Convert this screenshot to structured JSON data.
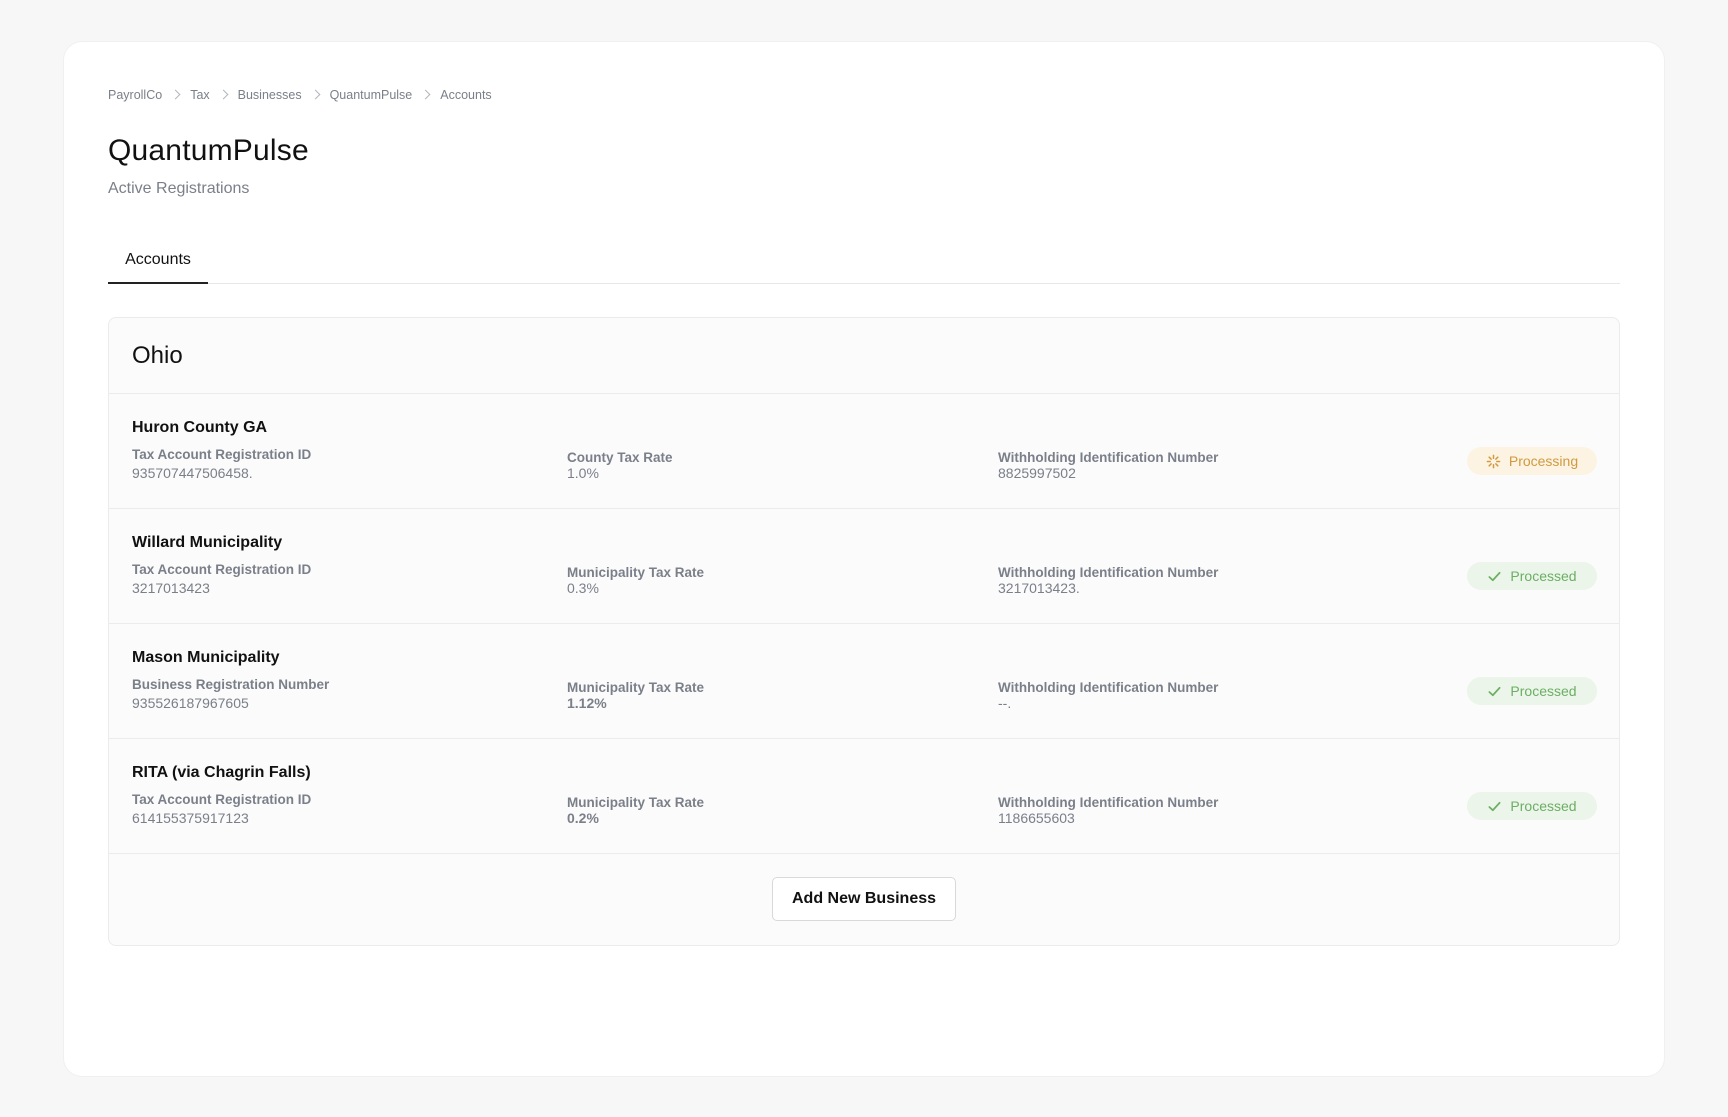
{
  "breadcrumb": [
    {
      "label": "PayrollCo"
    },
    {
      "label": "Tax"
    },
    {
      "label": "Businesses"
    },
    {
      "label": "QuantumPulse"
    },
    {
      "label": "Accounts"
    }
  ],
  "page": {
    "title": "QuantumPulse",
    "subtitle": "Active Registrations"
  },
  "tabs": [
    {
      "label": "Accounts",
      "active": true
    }
  ],
  "panel": {
    "state": "Ohio",
    "rows": [
      {
        "name": "Huron County GA",
        "id_label": "Tax Account Registration ID",
        "id_value": "935707447506458.",
        "rate_label": "County Tax Rate",
        "rate_value": "1.0%",
        "wh_label": "Withholding Identification Number",
        "wh_value": "8825997502",
        "status": "Processing",
        "status_icon": "spinner-icon"
      },
      {
        "name": "Willard Municipality",
        "id_label": "Tax Account Registration ID",
        "id_value": "3217013423",
        "rate_label": "Municipality Tax Rate",
        "rate_value": "0.3%",
        "wh_label": "Withholding Identification Number",
        "wh_value": "3217013423.",
        "status": "Processed",
        "status_icon": "check-icon"
      },
      {
        "name": "Mason Municipality",
        "id_label": "Business Registration Number",
        "id_value": "935526187967605",
        "rate_label": "Municipality Tax Rate",
        "rate_value": "1.12%",
        "wh_label": "Withholding Identification Number",
        "wh_value": "--.",
        "status": "Processed",
        "status_icon": "check-icon"
      },
      {
        "name": "RITA (via Chagrin Falls)",
        "id_label": "Tax Account Registration ID",
        "id_value": "614155375917123",
        "rate_label": "Municipality Tax Rate",
        "rate_value": "0.2%",
        "wh_label": "Withholding Identification Number",
        "wh_value": "1186655603",
        "status": "Processed",
        "status_icon": "check-icon"
      }
    ],
    "add_button": "Add New Business"
  },
  "colors": {
    "processing_bg": "#fdf3e3",
    "processing_fg": "#d09a3e",
    "processed_bg": "#ecf5ea",
    "processed_fg": "#6cae64"
  }
}
